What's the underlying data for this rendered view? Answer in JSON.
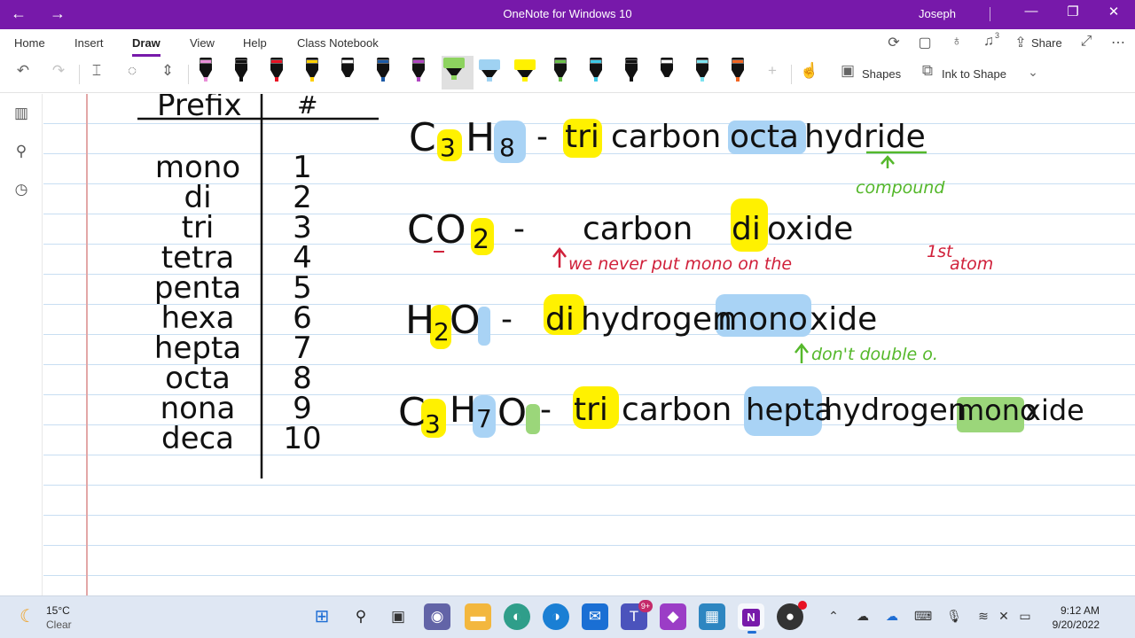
{
  "window": {
    "title": "OneNote for Windows 10",
    "user": "Joseph",
    "back_icon": "back-arrow-icon",
    "forward_icon": "forward-arrow-icon"
  },
  "ribbon": {
    "tabs": [
      "Home",
      "Insert",
      "Draw",
      "View",
      "Help",
      "Class Notebook"
    ],
    "active_tab": "Draw",
    "share_label": "Share",
    "notification_count": "3",
    "shapes_label": "Shapes",
    "ink_to_shape_label": "Ink to Shape",
    "pens": [
      {
        "name": "pen-black-pink",
        "band": "#e98fd8"
      },
      {
        "name": "pen-black",
        "band": "#111111"
      },
      {
        "name": "pen-red",
        "band": "#e81123"
      },
      {
        "name": "pen-yellow",
        "band": "#ffd000"
      },
      {
        "name": "pen-black-white",
        "band": "#ffffff"
      },
      {
        "name": "pen-dark-blue",
        "band": "#1c5aa6"
      },
      {
        "name": "pen-purple",
        "band": "#b146c2"
      }
    ],
    "highlighters": [
      {
        "name": "highlighter-green",
        "color": "#8dd35f"
      },
      {
        "name": "highlighter-light-blue",
        "color": "#9fd2f2"
      },
      {
        "name": "highlighter-yellow",
        "color": "#fff100"
      }
    ],
    "pens2": [
      {
        "name": "pen-green",
        "band": "#6cc24a"
      },
      {
        "name": "pen-cyan",
        "band": "#3cc8e6"
      },
      {
        "name": "pen-black-2",
        "band": "#111111"
      },
      {
        "name": "pen-white",
        "band": "#ffffff"
      },
      {
        "name": "pen-aqua",
        "band": "#7de3f0"
      },
      {
        "name": "pen-orange",
        "band": "#f26522"
      }
    ]
  },
  "colors": {
    "brand": "#7719aa",
    "highlight_yellow": "#fff100",
    "highlight_blue": "#a9d3f5",
    "highlight_green": "#9bd67a",
    "ink_red": "#d0203a",
    "ink_green": "#55b82b"
  },
  "notes": {
    "table_header_prefix": "Prefix",
    "table_header_number": "#",
    "prefixes": [
      "mono",
      "di",
      "tri",
      "tetra",
      "penta",
      "hexa",
      "hepta",
      "octa",
      "nona",
      "deca"
    ],
    "numbers": [
      "1",
      "2",
      "3",
      "4",
      "5",
      "6",
      "7",
      "8",
      "9",
      "10"
    ],
    "ex1": {
      "formula_c": "C",
      "sub_c": "3",
      "formula_h": "H",
      "sub_h": "8",
      "dash": "-",
      "name_prefix1": "tri",
      "name_word1": "carbon",
      "name_prefix2": "octa",
      "name_word2": "hydride",
      "note": "compound"
    },
    "ex2": {
      "formula_c": "C",
      "formula_o": "O",
      "sub_o": "2",
      "dash": "-",
      "name_word1": "carbon",
      "name_prefix2": "di",
      "name_word2": "oxide",
      "note": "we never put mono on the",
      "note_sup": "1st",
      "note_end": "atom"
    },
    "ex3": {
      "formula_h": "H",
      "sub_h": "2",
      "formula_o": "O",
      "dash": "-",
      "name_prefix1": "di",
      "name_word1": "hydrogen",
      "name_prefix2": "mono",
      "name_word2": "xide",
      "note": "don't double o."
    },
    "ex4": {
      "formula_c": "C",
      "sub_c": "3",
      "formula_h": "H",
      "sub_h": "7",
      "formula_o": "O",
      "dash": "-",
      "name_prefix1": "tri",
      "name_word1": "carbon",
      "name_prefix2": "hepta",
      "name_word2": "hydrogen",
      "name_prefix3": "mono",
      "name_word3": "xide"
    }
  },
  "taskbar": {
    "weather_temp": "15°C",
    "weather_desc": "Clear",
    "teams_badge": "9+",
    "time": "9:12 AM",
    "date": "9/20/2022"
  }
}
